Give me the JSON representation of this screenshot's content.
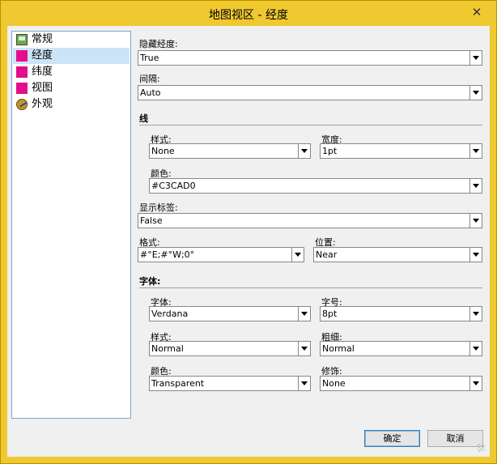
{
  "window": {
    "title": "地图视区 - 经度",
    "close_glyph": "✕"
  },
  "tree": {
    "items": [
      {
        "label": "常规",
        "icon": "general-image-icon"
      },
      {
        "label": "经度",
        "icon": "magenta-square-icon",
        "selected": true
      },
      {
        "label": "纬度",
        "icon": "magenta-square-icon"
      },
      {
        "label": "视图",
        "icon": "magenta-square-icon"
      },
      {
        "label": "外观",
        "icon": "appearance-palette-icon"
      }
    ]
  },
  "form": {
    "hide_longitude": {
      "label": "隐藏经度:",
      "value": "True"
    },
    "interval": {
      "label": "间隔:",
      "value": "Auto"
    },
    "line_section": "线",
    "line_style": {
      "label": "样式:",
      "value": "None"
    },
    "line_width": {
      "label": "宽度:",
      "value": "1pt"
    },
    "line_color": {
      "label": "颜色:",
      "value": "#C3CAD0"
    },
    "show_labels": {
      "label": "显示标签:",
      "value": "False"
    },
    "format": {
      "label": "格式:",
      "value": "#°E;#°W;0°"
    },
    "position": {
      "label": "位置:",
      "value": "Near"
    },
    "font_section": "字体:",
    "font_family": {
      "label": "字体:",
      "value": "Verdana"
    },
    "font_size": {
      "label": "字号:",
      "value": "8pt"
    },
    "font_style": {
      "label": "样式:",
      "value": "Normal"
    },
    "font_weight": {
      "label": "粗细:",
      "value": "Normal"
    },
    "font_color": {
      "label": "颜色:",
      "value": "Transparent"
    },
    "decoration": {
      "label": "修饰:",
      "value": "None"
    }
  },
  "buttons": {
    "ok": "确定",
    "cancel": "取消"
  }
}
